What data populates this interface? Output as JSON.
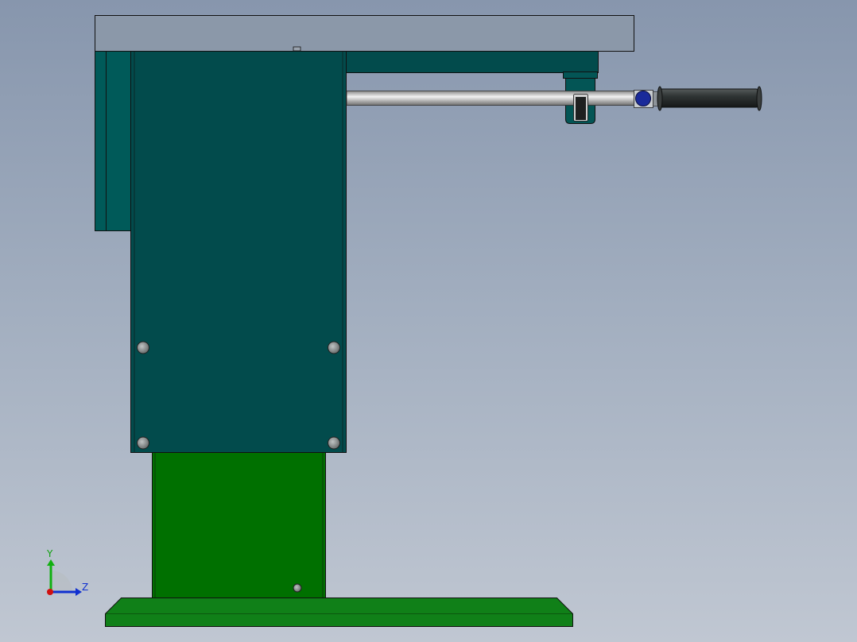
{
  "triad": {
    "y_label": "Y",
    "z_label": "Z"
  },
  "colors": {
    "background_top": "#8796ad",
    "background_bottom": "#c0c7d2",
    "top_plate": "#8a97a9",
    "dark_teal_body": "#024b4c",
    "teal_side_plate": "#005b5a",
    "green_column": "#007000",
    "green_base": "#118018",
    "rod": "#c8c8c8",
    "grip": "#2a2e2e",
    "nut_blue": "#1a2a9a",
    "bolt": "#8b8f8f",
    "axis_x": "#d01010",
    "axis_y": "#10b010",
    "axis_z": "#1030d0"
  }
}
